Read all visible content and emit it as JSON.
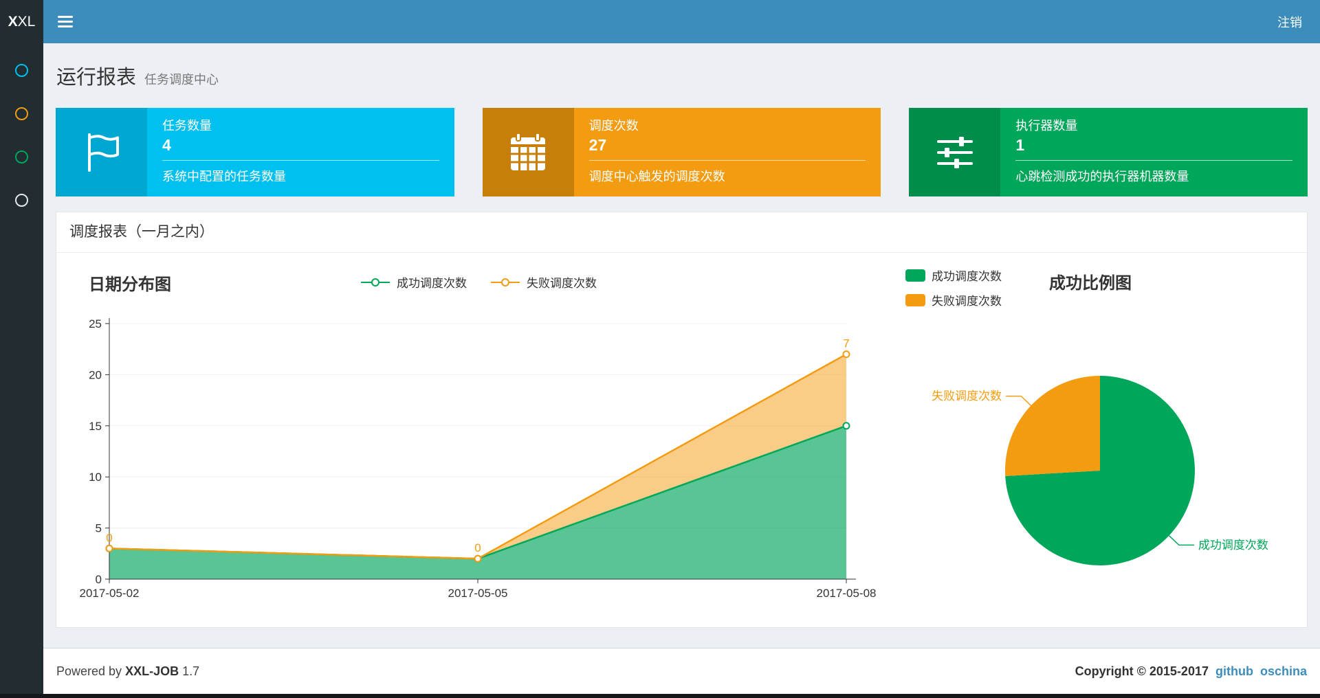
{
  "navbar": {
    "logo_bold": "X",
    "logo_rest": "XL",
    "logout_label": "注销"
  },
  "sidebar": {
    "items": [
      {
        "id": "report",
        "icon": "circle-o-icon",
        "color": "#00c0ef"
      },
      {
        "id": "job",
        "icon": "circle-o-icon",
        "color": "#f39c12"
      },
      {
        "id": "log",
        "icon": "circle-o-icon",
        "color": "#00a65a"
      },
      {
        "id": "executor",
        "icon": "circle-o-icon",
        "color": "#e8e8e8"
      }
    ]
  },
  "page_header": {
    "title": "运行报表",
    "subtitle": "任务调度中心"
  },
  "info_boxes": [
    {
      "icon": "flag-icon",
      "title": "任务数量",
      "value": "4",
      "desc": "系统中配置的任务数量",
      "color": "#00c0ef",
      "icon_bg": "#00a7d0"
    },
    {
      "icon": "calendar-icon",
      "title": "调度次数",
      "value": "27",
      "desc": "调度中心触发的调度次数",
      "color": "#f39c12",
      "icon_bg": "#c87f0a"
    },
    {
      "icon": "sliders-icon",
      "title": "执行器数量",
      "value": "1",
      "desc": "心跳检测成功的执行器机器数量",
      "color": "#00a65a",
      "icon_bg": "#008d4c"
    }
  ],
  "panel": {
    "title": "调度报表（一月之内）"
  },
  "chart_data": [
    {
      "type": "area",
      "title": "日期分布图",
      "x": [
        "2017-05-02",
        "2017-05-05",
        "2017-05-08"
      ],
      "series": [
        {
          "name": "成功调度次数",
          "values": [
            3,
            2,
            15
          ],
          "color": "#00a65a"
        },
        {
          "name": "失败调度次数",
          "values": [
            0,
            0,
            7
          ],
          "color": "#f39c12",
          "labels": [
            "0",
            "0",
            "7"
          ]
        }
      ],
      "stacked": true,
      "ylim": [
        0,
        25
      ],
      "yticks": [
        0,
        5,
        10,
        15,
        20,
        25
      ],
      "legend_position": "top-center",
      "grid": "faint"
    },
    {
      "type": "pie",
      "title": "成功比例图",
      "slices": [
        {
          "name": "成功调度次数",
          "value": 20,
          "color": "#00a65a"
        },
        {
          "name": "失败调度次数",
          "value": 7,
          "color": "#f39c12"
        }
      ],
      "start_angle": 90,
      "legend_position": "top-left"
    }
  ],
  "footer": {
    "powered_prefix": "Powered by",
    "brand": "XXL-JOB",
    "version": "1.7",
    "copyright": "Copyright © 2015-2017",
    "links": [
      "github",
      "oschina"
    ]
  },
  "colors": {
    "navbar": "#3c8dbc",
    "logo_bg": "#222d32",
    "sidebar": "#222d32",
    "content_bg": "#ecf0f5",
    "link": "#3c8dbc"
  }
}
